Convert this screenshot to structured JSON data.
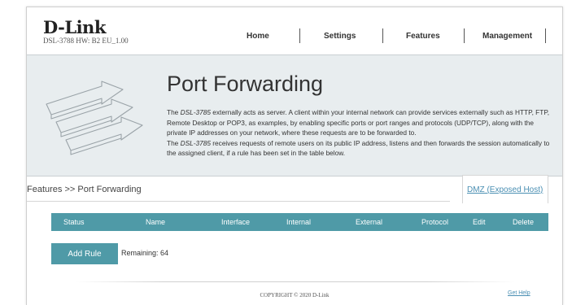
{
  "header": {
    "brand": "D-Link",
    "model": "DSL-3788  HW: B2  EU_1.00"
  },
  "nav": {
    "items": [
      {
        "label": "Home"
      },
      {
        "label": "Settings"
      },
      {
        "label": "Features"
      },
      {
        "label": "Management"
      }
    ]
  },
  "banner": {
    "title": "Port Forwarding",
    "desc": {
      "p1_pre": "The ",
      "p1_model": "DSL-3785",
      "p1_post": " externally acts as server. A client within your internal network can provide services externally such as HTTP, FTP, Remote Desktop or POP3, as examples, by enabling specific ports or port ranges and protocols (UDP/TCP), along with the private IP addresses on your network, where these requests are to be forwarded to.",
      "p2_pre": "The ",
      "p2_model": "DSL-3785",
      "p2_post": " receives requests of remote users on its public IP address, listens and then forwards the session automatically to the assigned client, if a rule has been set in the table below."
    }
  },
  "breadcrumb": "Features >> Port Forwarding",
  "dmz_link": "DMZ (Exposed Host)",
  "table": {
    "columns": [
      "Status",
      "Name",
      "Interface",
      "Internal",
      "External",
      "Protocol",
      "Edit",
      "Delete"
    ]
  },
  "add_rule": {
    "label": "Add Rule",
    "remaining": "Remaining: 64"
  },
  "footer": {
    "copyright": "COPYRIGHT © 2020 D-Link",
    "help": "Get Help"
  },
  "colors": {
    "accent": "#4f9aa7",
    "banner_bg": "#e8edef",
    "link": "#4a8fb3"
  }
}
